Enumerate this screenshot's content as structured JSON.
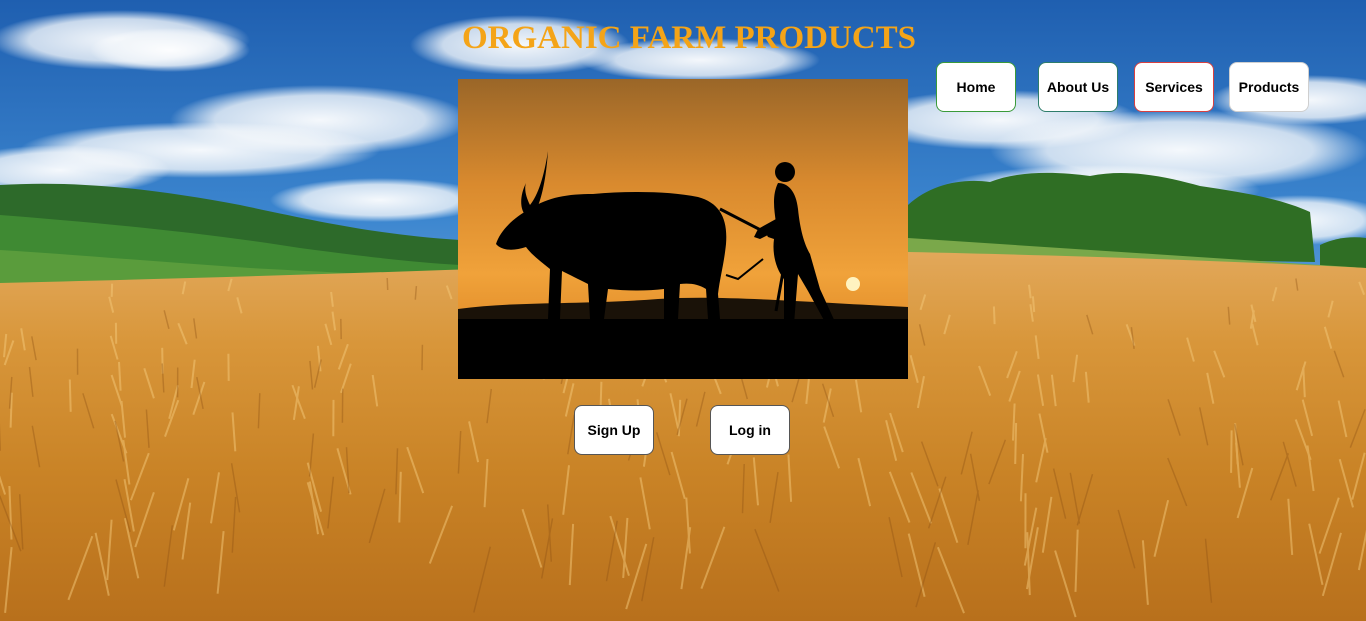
{
  "header": {
    "title": "ORGANIC FARM PRODUCTS"
  },
  "nav": {
    "items": [
      {
        "label": "Home"
      },
      {
        "label": "About Us"
      },
      {
        "label": "Services"
      },
      {
        "label": "Products"
      }
    ]
  },
  "auth": {
    "signup_label": "Sign Up",
    "login_label": "Log in"
  },
  "colors": {
    "title": "#f4a418",
    "sky": "#2a74c4",
    "wheat": "#d9952e",
    "sunset": "#e8922a"
  }
}
